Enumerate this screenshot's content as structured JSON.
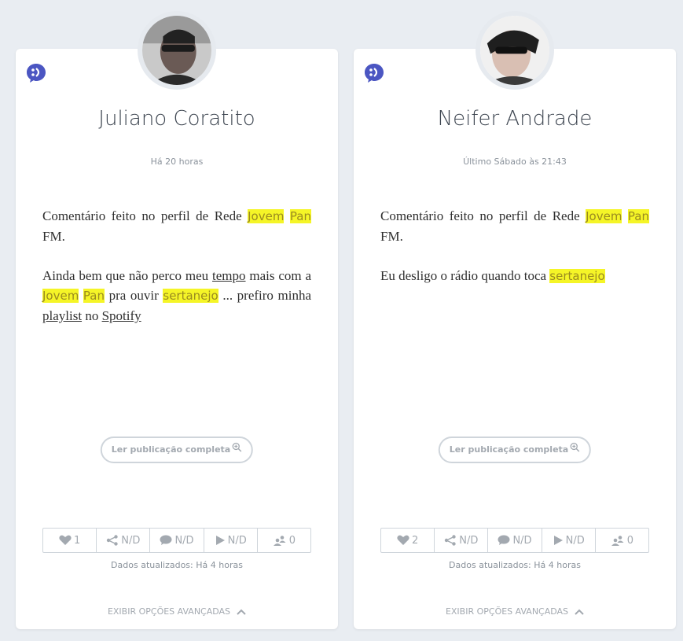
{
  "colors": {
    "accent": "#4b56c2",
    "highlight": "#f5f527",
    "muted": "#a3a9b0"
  },
  "cards": [
    {
      "name": "Juliano Coratito",
      "time": "Há 20 horas",
      "intro_prefix": "Comentário feito no perfil de Rede",
      "intro_hl1": "Jovem",
      "intro_hl2": "Pan",
      "intro_suffix": "FM.",
      "body": {
        "t1": "Ainda bem que não perco meu",
        "u1": "tempo",
        "t2": "mais com a",
        "h1": "Jovem",
        "h2": "Pan",
        "t3": "pra ouvir",
        "h3": "sertanejo",
        "t4": "... prefiro minha",
        "u2": "playlist",
        "t5": "no",
        "u3": "Spotify"
      },
      "read_label": "Ler publicação completa",
      "stats": {
        "likes": "1",
        "shares": "N/D",
        "comments": "N/D",
        "views": "N/D",
        "reach": "0"
      },
      "updated": "Dados atualizados: Há 4 horas",
      "advanced": "EXIBIR OPÇÕES AVANÇADAS"
    },
    {
      "name": "Neifer Andrade",
      "time": "Último Sábado às 21:43",
      "intro_prefix": "Comentário feito no perfil de Rede",
      "intro_hl1": "Jovem",
      "intro_hl2": "Pan",
      "intro_suffix": "FM.",
      "body": {
        "t1": "Eu desligo o rádio quando toca",
        "h1": "sertanejo"
      },
      "read_label": "Ler publicação completa",
      "stats": {
        "likes": "2",
        "shares": "N/D",
        "comments": "N/D",
        "views": "N/D",
        "reach": "0"
      },
      "updated": "Dados atualizados: Há 4 horas",
      "advanced": "EXIBIR OPÇÕES AVANÇADAS"
    }
  ]
}
